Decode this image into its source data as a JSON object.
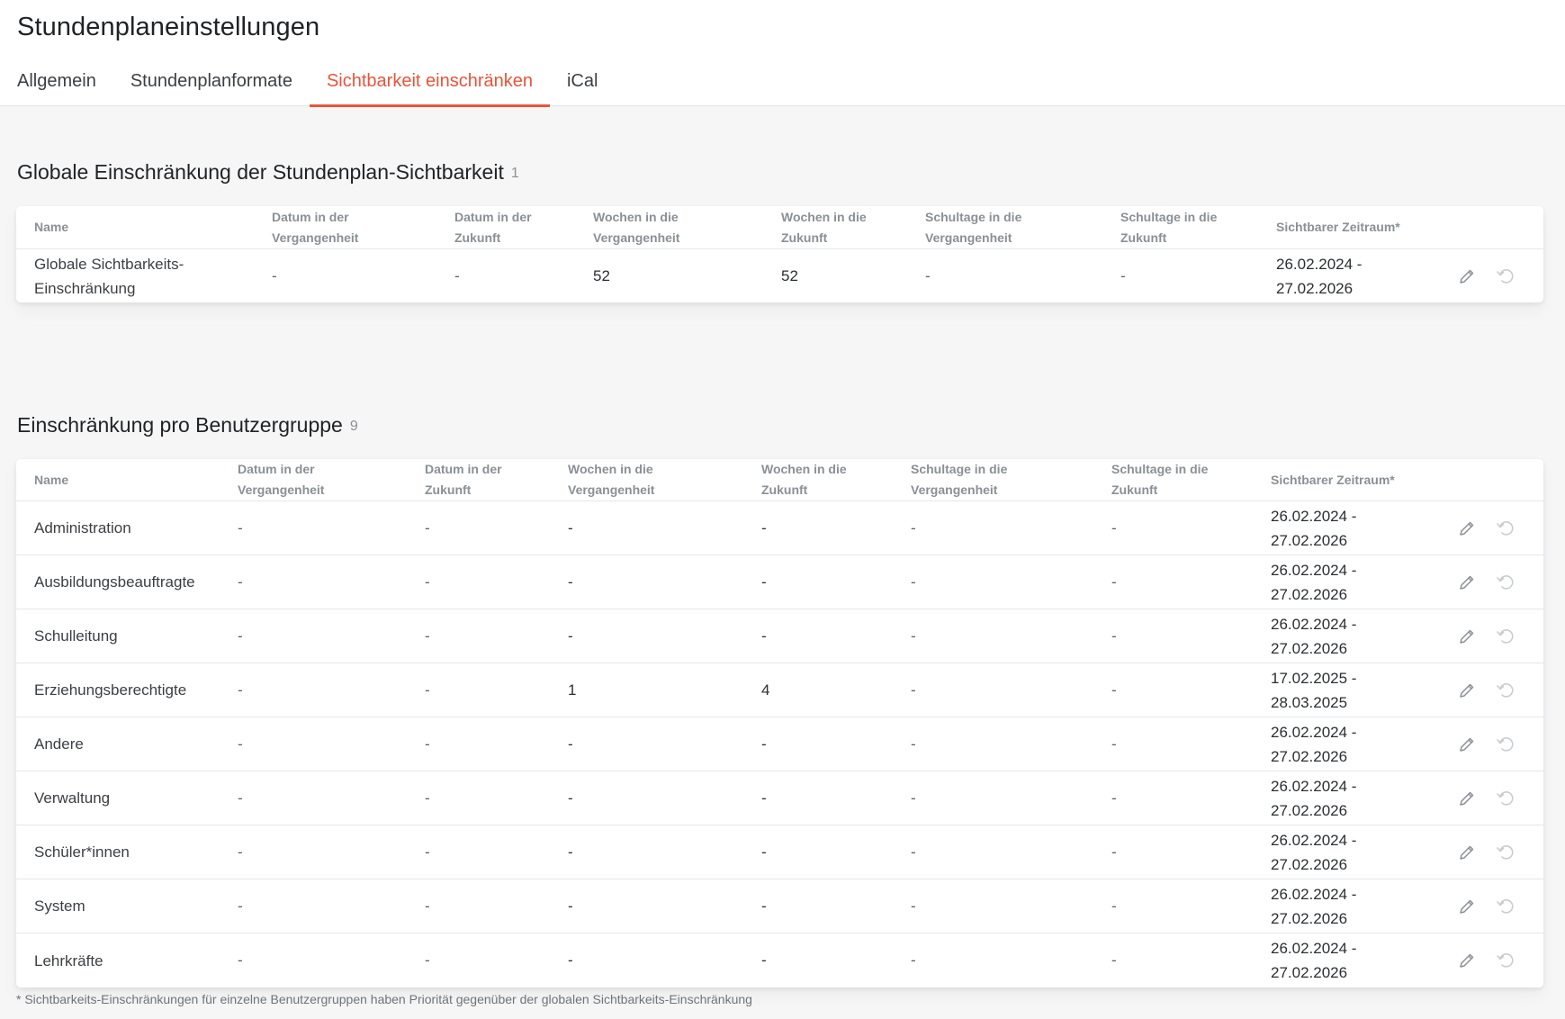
{
  "page": {
    "title": "Stundenplaneinstellungen"
  },
  "tabs": [
    {
      "label": "Allgemein",
      "active": false
    },
    {
      "label": "Stundenplanformate",
      "active": false
    },
    {
      "label": "Sichtbarkeit einschränken",
      "active": true
    },
    {
      "label": "iCal",
      "active": false
    }
  ],
  "colors": {
    "accent": "#e9543a",
    "background": "#f6f6f7",
    "card": "#ffffff"
  },
  "global_section": {
    "title": "Globale Einschränkung der Stundenplan-Sichtbarkeit",
    "count": "1",
    "columns": {
      "name": "Name",
      "date_past_1": "Datum in der",
      "date_past_2": "Vergangenheit",
      "date_future_1": "Datum in der",
      "date_future_2": "Zukunft",
      "weeks_past_1": "Wochen in die",
      "weeks_past_2": "Vergangenheit",
      "weeks_future_1": "Wochen in die",
      "weeks_future_2": "Zukunft",
      "days_past_1": "Schultage in die",
      "days_past_2": "Vergangenheit",
      "days_future_1": "Schultage in die",
      "days_future_2": "Zukunft",
      "range": "Sichtbarer Zeitraum*"
    },
    "rows": [
      {
        "name_1": "Globale Sichtbarkeits-",
        "name_2": "Einschränkung",
        "date_past": "-",
        "date_future": "-",
        "weeks_past": "52",
        "weeks_future": "52",
        "days_past": "-",
        "days_future": "-",
        "range_1": "26.02.2024 -",
        "range_2": "27.02.2026",
        "edit_icon": "pencil-icon",
        "reset_icon": "undo-icon"
      }
    ]
  },
  "group_section": {
    "title": "Einschränkung pro Benutzergruppe",
    "count": "9",
    "columns": {
      "name": "Name",
      "date_past_1": "Datum in der",
      "date_past_2": "Vergangenheit",
      "date_future_1": "Datum in der",
      "date_future_2": "Zukunft",
      "weeks_past_1": "Wochen in die",
      "weeks_past_2": "Vergangenheit",
      "weeks_future_1": "Wochen in die",
      "weeks_future_2": "Zukunft",
      "days_past_1": "Schultage in die",
      "days_past_2": "Vergangenheit",
      "days_future_1": "Schultage in die",
      "days_future_2": "Zukunft",
      "range": "Sichtbarer Zeitraum*"
    },
    "rows": [
      {
        "name": "Administration",
        "date_past": "-",
        "date_future": "-",
        "weeks_past": "-",
        "weeks_future": "-",
        "days_past": "-",
        "days_future": "-",
        "range_1": "26.02.2024 -",
        "range_2": "27.02.2026"
      },
      {
        "name": "Ausbildungsbeauftragte",
        "date_past": "-",
        "date_future": "-",
        "weeks_past": "-",
        "weeks_future": "-",
        "days_past": "-",
        "days_future": "-",
        "range_1": "26.02.2024 -",
        "range_2": "27.02.2026"
      },
      {
        "name": "Schulleitung",
        "date_past": "-",
        "date_future": "-",
        "weeks_past": "-",
        "weeks_future": "-",
        "days_past": "-",
        "days_future": "-",
        "range_1": "26.02.2024 -",
        "range_2": "27.02.2026"
      },
      {
        "name": "Erziehungsberechtigte",
        "date_past": "-",
        "date_future": "-",
        "weeks_past": "1",
        "weeks_future": "4",
        "days_past": "-",
        "days_future": "-",
        "range_1": "17.02.2025 -",
        "range_2": "28.03.2025"
      },
      {
        "name": "Andere",
        "date_past": "-",
        "date_future": "-",
        "weeks_past": "-",
        "weeks_future": "-",
        "days_past": "-",
        "days_future": "-",
        "range_1": "26.02.2024 -",
        "range_2": "27.02.2026"
      },
      {
        "name": "Verwaltung",
        "date_past": "-",
        "date_future": "-",
        "weeks_past": "-",
        "weeks_future": "-",
        "days_past": "-",
        "days_future": "-",
        "range_1": "26.02.2024 -",
        "range_2": "27.02.2026"
      },
      {
        "name": "Schüler*innen",
        "date_past": "-",
        "date_future": "-",
        "weeks_past": "-",
        "weeks_future": "-",
        "days_past": "-",
        "days_future": "-",
        "range_1": "26.02.2024 -",
        "range_2": "27.02.2026"
      },
      {
        "name": "System",
        "date_past": "-",
        "date_future": "-",
        "weeks_past": "-",
        "weeks_future": "-",
        "days_past": "-",
        "days_future": "-",
        "range_1": "26.02.2024 -",
        "range_2": "27.02.2026"
      },
      {
        "name": "Lehrkräfte",
        "date_past": "-",
        "date_future": "-",
        "weeks_past": "-",
        "weeks_future": "-",
        "days_past": "-",
        "days_future": "-",
        "range_1": "26.02.2024 -",
        "range_2": "27.02.2026"
      }
    ]
  },
  "footnote": "* Sichtbarkeits-Einschränkungen für einzelne Benutzergruppen haben Priorität gegenüber der globalen Sichtbarkeits-Einschränkung"
}
